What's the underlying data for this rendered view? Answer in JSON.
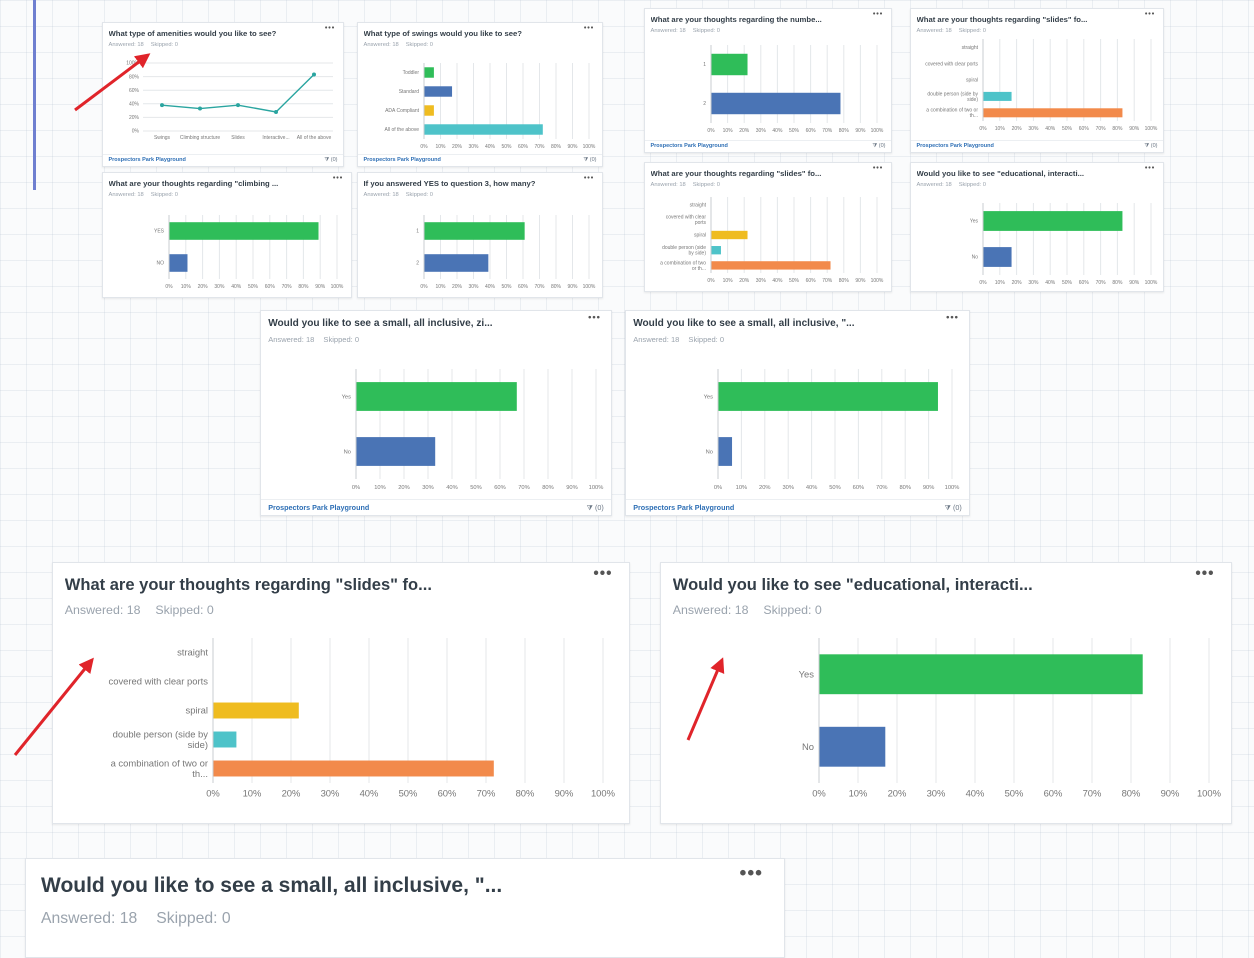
{
  "dashboard": {
    "colors": {
      "green": "#2fbd59",
      "blue": "#4a74b5",
      "yellow": "#efbc20",
      "teal": "#4ec3c9",
      "orange": "#f28a4b",
      "line": "#2aa5a0",
      "grid": "#e4e7ea",
      "arrow": "#e0242a"
    },
    "more_label": "•••",
    "filter_label": "⧩ (0)",
    "cards": [
      {
        "id": "c1",
        "title": "What type of amenities would you like to see?",
        "answered": "Answered: 18",
        "skipped": "Skipped: 0",
        "footer": "Prospectors Park Playground",
        "filter": "⧩ (0)",
        "chart_data": {
          "type": "line",
          "categories": [
            "Swings",
            "Climbing structure",
            "Slides",
            "Interactive...",
            "All of the above"
          ],
          "values": [
            38,
            33,
            38,
            28,
            83
          ],
          "yticks": [
            "0%",
            "20%",
            "40%",
            "60%",
            "80%",
            "100%"
          ],
          "ylim": [
            0,
            100
          ]
        }
      },
      {
        "id": "c2",
        "title": "What type of swings would you like to see?",
        "answered": "Answered: 18",
        "skipped": "Skipped: 0",
        "footer": "Prospectors Park Playground",
        "filter": "⧩ (0)",
        "chart_data": {
          "type": "bar",
          "categories": [
            "Toddler",
            "Standard",
            "ADA Compliant",
            "All of the above"
          ],
          "values": [
            6,
            17,
            6,
            72
          ],
          "colors": [
            "green",
            "blue",
            "yellow",
            "teal"
          ],
          "xticks": [
            "0%",
            "10%",
            "20%",
            "30%",
            "40%",
            "50%",
            "60%",
            "70%",
            "80%",
            "90%",
            "100%"
          ],
          "xlim": [
            0,
            100
          ]
        }
      },
      {
        "id": "c3",
        "title": "What are your thoughts regarding the numbe...",
        "answered": "Answered: 18",
        "skipped": "Skipped: 0",
        "footer": "Prospectors Park Playground",
        "filter": "⧩ (0)",
        "chart_data": {
          "type": "bar",
          "categories": [
            "1",
            "2"
          ],
          "values": [
            22,
            78
          ],
          "colors": [
            "green",
            "blue"
          ],
          "xticks": [
            "0%",
            "10%",
            "20%",
            "30%",
            "40%",
            "50%",
            "60%",
            "70%",
            "80%",
            "90%",
            "100%"
          ],
          "xlim": [
            0,
            100
          ]
        }
      },
      {
        "id": "c4",
        "title": "What are your thoughts regarding \"slides\" fo...",
        "answered": "Answered: 18",
        "skipped": "Skipped: 0",
        "footer": "Prospectors Park Playground",
        "filter": "⧩ (0)",
        "chart_data": {
          "type": "bar",
          "categories": [
            "straight",
            "covered with clear ports",
            "spiral",
            "double person (side by side)",
            "a combination of two or th..."
          ],
          "values": [
            0,
            0,
            0,
            17,
            83
          ],
          "colors": [
            "green",
            "blue",
            "yellow",
            "teal",
            "orange"
          ],
          "xticks": [
            "0%",
            "10%",
            "20%",
            "30%",
            "40%",
            "50%",
            "60%",
            "70%",
            "80%",
            "90%",
            "100%"
          ],
          "xlim": [
            0,
            100
          ]
        }
      },
      {
        "id": "c5",
        "title": "What are your thoughts regarding \"climbing ...",
        "answered": "Answered: 18",
        "skipped": "Skipped: 0",
        "footer": "",
        "filter": "",
        "chart_data": {
          "type": "bar",
          "categories": [
            "YES",
            "NO"
          ],
          "values": [
            89,
            11
          ],
          "colors": [
            "green",
            "blue"
          ],
          "xticks": [
            "0%",
            "10%",
            "20%",
            "30%",
            "40%",
            "50%",
            "60%",
            "70%",
            "80%",
            "90%",
            "100%"
          ],
          "xlim": [
            0,
            100
          ]
        }
      },
      {
        "id": "c6",
        "title": "If you answered YES to question 3, how many?",
        "answered": "Answered: 18",
        "skipped": "Skipped: 0",
        "footer": "",
        "filter": "",
        "chart_data": {
          "type": "bar",
          "categories": [
            "1",
            "2"
          ],
          "values": [
            61,
            39
          ],
          "colors": [
            "green",
            "blue"
          ],
          "xticks": [
            "0%",
            "10%",
            "20%",
            "30%",
            "40%",
            "50%",
            "60%",
            "70%",
            "80%",
            "90%",
            "100%"
          ],
          "xlim": [
            0,
            100
          ]
        }
      },
      {
        "id": "c7",
        "title": "What are your thoughts regarding \"slides\" fo...",
        "answered": "Answered: 18",
        "skipped": "Skipped: 0",
        "footer": "",
        "filter": "",
        "chart_data": {
          "type": "bar",
          "categories": [
            "straight",
            "covered with clear ports",
            "spiral",
            "double person (side by side)",
            "a combination of two or th..."
          ],
          "values": [
            0,
            0,
            22,
            6,
            72
          ],
          "colors": [
            "green",
            "blue",
            "yellow",
            "teal",
            "orange"
          ],
          "xticks": [
            "0%",
            "10%",
            "20%",
            "30%",
            "40%",
            "50%",
            "60%",
            "70%",
            "80%",
            "90%",
            "100%"
          ],
          "xlim": [
            0,
            100
          ]
        }
      },
      {
        "id": "c8",
        "title": "Would you like to see \"educational, interacti...",
        "answered": "Answered: 18",
        "skipped": "Skipped: 0",
        "footer": "",
        "filter": "",
        "chart_data": {
          "type": "bar",
          "categories": [
            "Yes",
            "No"
          ],
          "values": [
            83,
            17
          ],
          "colors": [
            "green",
            "blue"
          ],
          "xticks": [
            "0%",
            "10%",
            "20%",
            "30%",
            "40%",
            "50%",
            "60%",
            "70%",
            "80%",
            "90%",
            "100%"
          ],
          "xlim": [
            0,
            100
          ]
        }
      },
      {
        "id": "c9",
        "title": "Would you like to see a small, all inclusive, zi...",
        "answered": "Answered: 18",
        "skipped": "Skipped: 0",
        "footer": "Prospectors Park Playground",
        "filter": "⧩ (0)",
        "chart_data": {
          "type": "bar",
          "categories": [
            "Yes",
            "No"
          ],
          "values": [
            67,
            33
          ],
          "colors": [
            "green",
            "blue"
          ],
          "xticks": [
            "0%",
            "10%",
            "20%",
            "30%",
            "40%",
            "50%",
            "60%",
            "70%",
            "80%",
            "90%",
            "100%"
          ],
          "xlim": [
            0,
            100
          ]
        }
      },
      {
        "id": "c10",
        "title": "Would you like to see a small, all inclusive, \"...",
        "answered": "Answered: 18",
        "skipped": "Skipped: 0",
        "footer": "Prospectors Park Playground",
        "filter": "⧩ (0)",
        "chart_data": {
          "type": "bar",
          "categories": [
            "Yes",
            "No"
          ],
          "values": [
            94,
            6
          ],
          "colors": [
            "green",
            "blue"
          ],
          "xticks": [
            "0%",
            "10%",
            "20%",
            "30%",
            "40%",
            "50%",
            "60%",
            "70%",
            "80%",
            "90%",
            "100%"
          ],
          "xlim": [
            0,
            100
          ]
        }
      },
      {
        "id": "c11",
        "title": "What are your thoughts regarding \"slides\" fo...",
        "answered": "Answered: 18",
        "skipped": "Skipped: 0",
        "footer": "",
        "filter": "",
        "chart_data": {
          "type": "bar",
          "categories": [
            "straight",
            "covered with clear ports",
            "spiral",
            "double person (side by side)",
            "a combination of two or th..."
          ],
          "values": [
            0,
            0,
            22,
            6,
            72
          ],
          "colors": [
            "green",
            "blue",
            "yellow",
            "teal",
            "orange"
          ],
          "xticks": [
            "0%",
            "10%",
            "20%",
            "30%",
            "40%",
            "50%",
            "60%",
            "70%",
            "80%",
            "90%",
            "100%"
          ],
          "xlim": [
            0,
            100
          ]
        }
      },
      {
        "id": "c12",
        "title": "Would you like to see \"educational, interacti...",
        "answered": "Answered: 18",
        "skipped": "Skipped: 0",
        "footer": "",
        "filter": "",
        "chart_data": {
          "type": "bar",
          "categories": [
            "Yes",
            "No"
          ],
          "values": [
            83,
            17
          ],
          "colors": [
            "green",
            "blue"
          ],
          "xticks": [
            "0%",
            "10%",
            "20%",
            "30%",
            "40%",
            "50%",
            "60%",
            "70%",
            "80%",
            "90%",
            "100%"
          ],
          "xlim": [
            0,
            100
          ]
        }
      },
      {
        "id": "c13",
        "title": "Would you like to see a small, all inclusive, \"...",
        "answered": "Answered: 18",
        "skipped": "Skipped: 0",
        "footer": "",
        "filter": "",
        "chart_data": null
      }
    ]
  }
}
